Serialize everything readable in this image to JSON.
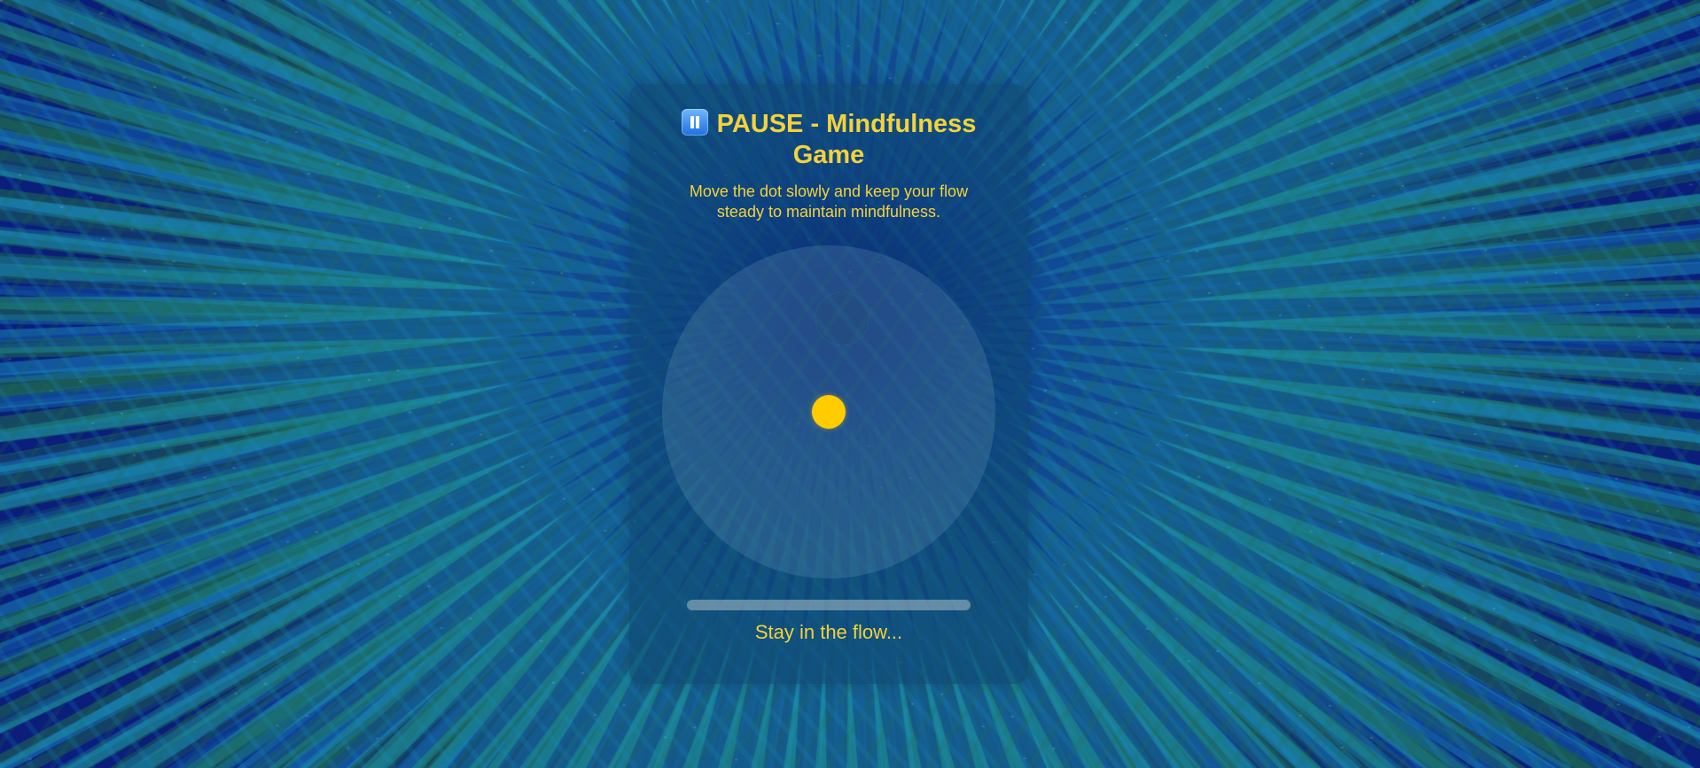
{
  "game": {
    "title": "PAUSE - Mindfulness Game",
    "title_icon": "pause-icon",
    "instructions": "Move the dot slowly and keep your flow steady to maintain mindfulness.",
    "status": "Stay in the flow...",
    "flow_level": 0
  },
  "colors": {
    "accent": "#f4d23c",
    "dot": "#ffcc00",
    "background_dark": "#0a1e7a",
    "background_teal": "#1a8fc0",
    "background_green": "#1f6e4e"
  }
}
